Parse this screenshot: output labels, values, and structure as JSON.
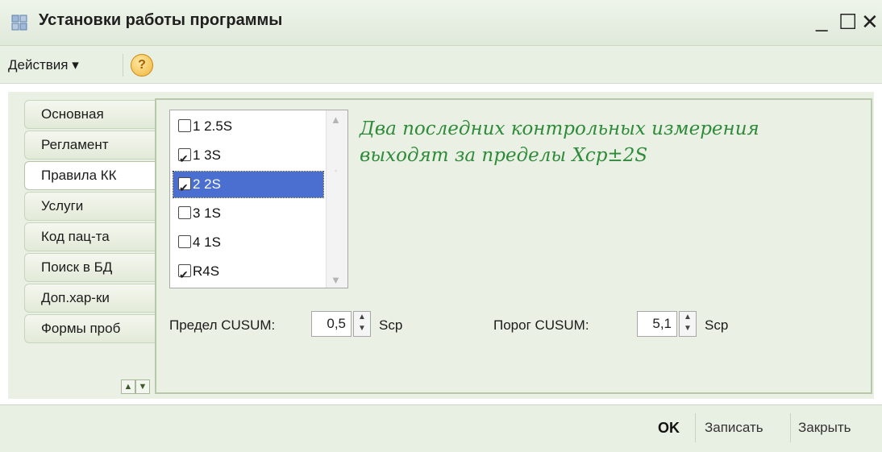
{
  "window": {
    "title": "Установки работы программы",
    "controls": {
      "minimize": "_",
      "maximize": "☐",
      "close": "✕"
    }
  },
  "toolbar": {
    "actions_label": "Действия ▾",
    "help_label": "?"
  },
  "tabs": [
    {
      "label": "Основная",
      "active": false
    },
    {
      "label": "Регламент",
      "active": false
    },
    {
      "label": "Правила КК",
      "active": true
    },
    {
      "label": "Услуги",
      "active": false
    },
    {
      "label": "Код пац-та",
      "active": false
    },
    {
      "label": "Поиск в БД",
      "active": false
    },
    {
      "label": "Доп.хар-ки",
      "active": false
    },
    {
      "label": "Формы проб",
      "active": false
    }
  ],
  "rules": [
    {
      "label": "1 2.5S",
      "checked": false,
      "selected": false
    },
    {
      "label": "1 3S",
      "checked": true,
      "selected": false
    },
    {
      "label": "2 2S",
      "checked": true,
      "selected": true
    },
    {
      "label": "3 1S",
      "checked": false,
      "selected": false
    },
    {
      "label": "4 1S",
      "checked": false,
      "selected": false
    },
    {
      "label": "R4S",
      "checked": true,
      "selected": false
    }
  ],
  "rule_description": "Два последних контрольных измерения выходят за пределы Хср±2S",
  "cusum": {
    "limit_label": "Предел CUSUM:",
    "limit_value": "0,5",
    "limit_unit": "Scp",
    "threshold_label": "Порог CUSUM:",
    "threshold_value": "5,1",
    "threshold_unit": "Scp"
  },
  "footer": {
    "ok_label": "OK",
    "save_label": "Записать",
    "close_label": "Закрыть"
  },
  "colors": {
    "accent_green": "#2e8b3a",
    "selection_blue": "#4a6fd1",
    "panel_bg": "#eaf0e4"
  }
}
